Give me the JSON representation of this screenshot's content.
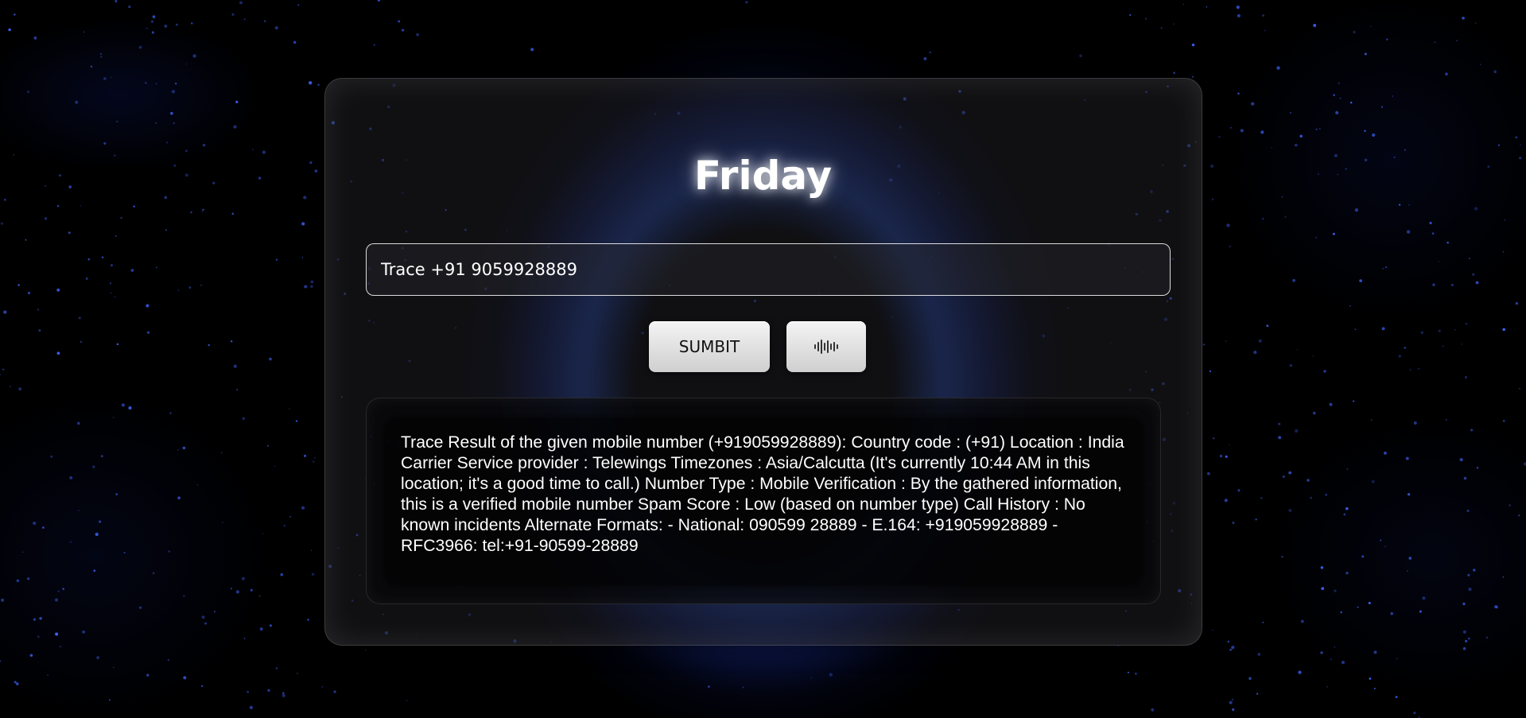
{
  "app": {
    "title": "Friday"
  },
  "search": {
    "value": "Trace +91 9059928889"
  },
  "buttons": {
    "submit_label": "SUMBIT",
    "voice_icon": "sound-wave-icon"
  },
  "result": {
    "text": "Trace Result of the given mobile number (+919059928889): Country code : (+91) Location : India Carrier Service provider : Telewings Timezones : Asia/Calcutta (It's currently 10:44 AM in this location; it's a good time to call.) Number Type : Mobile Verification : By the gathered information, this is a verified mobile number Spam Score : Low (based on number type) Call History : No known incidents Alternate Formats: - National: 090599 28889 - E.164: +919059928889 - RFC3966: tel:+91-90599-28889"
  },
  "colors": {
    "background": "#000000",
    "accent_glow": "#2a5ae6",
    "button_face": "#e6e6e6",
    "text": "#ffffff"
  }
}
